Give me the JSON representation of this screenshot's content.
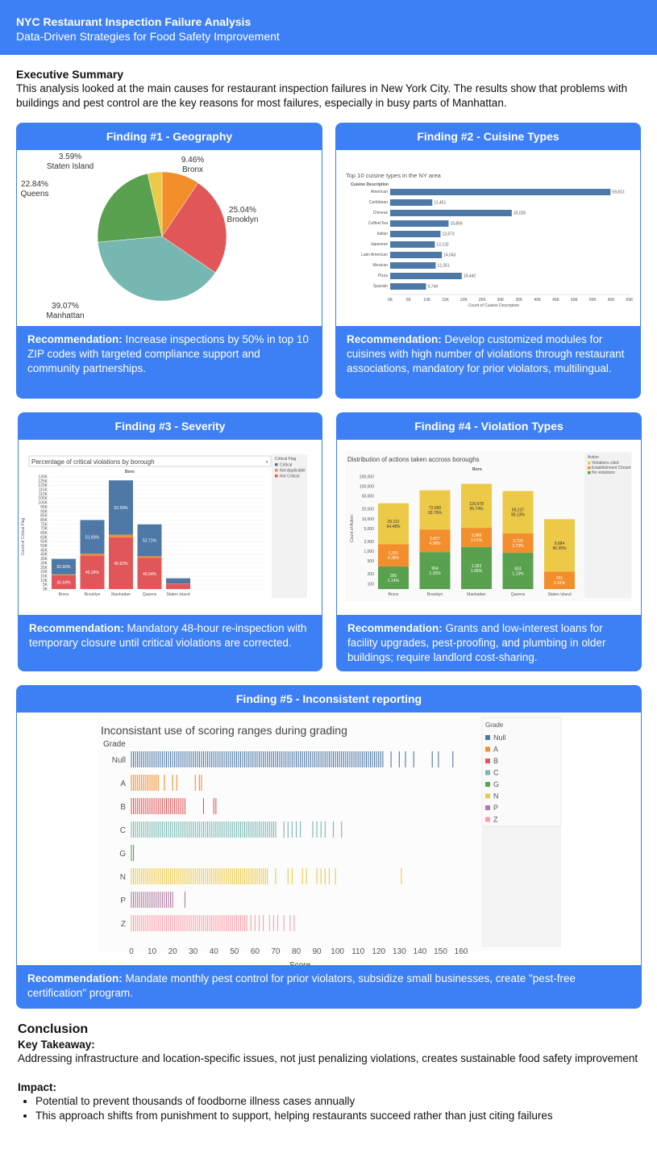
{
  "header": {
    "title": "NYC Restaurant Inspection Failure Analysis",
    "subtitle": "Data-Driven Strategies for Food Safety Improvement"
  },
  "executive_summary": {
    "heading": "Executive Summary",
    "text": "This analysis looked at the main causes for restaurant inspection failures in New York City. The results show that problems with buildings and pest control are the key reasons for most failures, especially in busy parts of Manhattan."
  },
  "findings": [
    {
      "title": "Finding #1 - Geography",
      "rec_label": "Recommendation:",
      "rec_text": " Increase inspections by 50% in top 10 ZIP codes with targeted compliance support and community partnerships."
    },
    {
      "title": "Finding #2 - Cuisine Types",
      "rec_label": "Recommendation:",
      "rec_text": " Develop customized modules for cuisines with high number of violations through restaurant associations, mandatory for prior violators, multilingual."
    },
    {
      "title": "Finding #3 - Severity",
      "rec_label": "Recommendation:",
      "rec_text": " Mandatory 48-hour re-inspection with temporary closure until critical violations are corrected."
    },
    {
      "title": "Finding #4 - Violation Types",
      "rec_label": "Recommendation:",
      "rec_text": " Grants and low-interest loans for facility upgrades, pest-proofing, and plumbing in older buildings; require landlord cost-sharing."
    },
    {
      "title": "Finding #5 - Inconsistent reporting",
      "rec_label": "Recommendation:",
      "rec_text": " Mandate monthly pest control for prior violators, subsidize small businesses, create \"pest-free certification\" program."
    }
  ],
  "conclusion": {
    "heading": "Conclusion",
    "takeaway_heading": "Key Takeaway:",
    "takeaway_text": "Addressing infrastructure and location-specific issues, not just penalizing violations, creates sustainable food safety improvement",
    "impact_heading": "Impact:",
    "impact_items": [
      "Potential to prevent thousands of foodborne illness cases annually",
      "This approach shifts from punishment to support, helping restaurants succeed rather than just citing failures"
    ]
  },
  "chart_data": [
    {
      "type": "pie",
      "title": "",
      "labels": [
        "Bronx",
        "Brooklyn",
        "Manhattan",
        "Queens",
        "Staten Island"
      ],
      "values": [
        9.46,
        25.04,
        39.07,
        22.84,
        3.59
      ],
      "value_labels": [
        "9.46%",
        "25.04%",
        "39.07%",
        "22.84%",
        "3.59%"
      ],
      "colors": [
        "#f28e2b",
        "#e15759",
        "#76b7b2",
        "#59a14f",
        "#edc948"
      ]
    },
    {
      "type": "bar",
      "title": "Top 10 cuisine types in the NY area",
      "ylabel": "Cuisine Description",
      "xlabel": "Count of Cuisine Description",
      "categories": [
        "American",
        "Caribbean",
        "Chinese",
        "Coffee/Tea",
        "Italian",
        "Japanese",
        "Latin American",
        "Mexican",
        "Pizza",
        "Spanish"
      ],
      "values": [
        59813,
        11451,
        33026,
        15856,
        13673,
        12132,
        14043,
        12351,
        19440,
        9744
      ],
      "value_labels": [
        "59,813",
        "11,451",
        "33,026",
        "15,856",
        "13,673",
        "12,132",
        "14,043",
        "12,351",
        "19,440",
        "9,744"
      ],
      "xticks": [
        "0K",
        "5K",
        "10K",
        "15K",
        "20K",
        "25K",
        "30K",
        "35K",
        "40K",
        "45K",
        "50K",
        "55K",
        "60K",
        "65K"
      ],
      "xlim": [
        0,
        65000
      ],
      "color": "#4e79a7"
    },
    {
      "type": "bar",
      "title": "Percentage of critical violations by borough",
      "xlabel": "Boro",
      "ylabel": "Count of Critical Flag",
      "categories": [
        "Bronx",
        "Brooklyn",
        "Manhattan",
        "Queens",
        "Staten Island"
      ],
      "yticks": [
        "0K",
        "5K",
        "10K",
        "15K",
        "20K",
        "25K",
        "30K",
        "35K",
        "40K",
        "45K",
        "50K",
        "55K",
        "60K",
        "65K",
        "70K",
        "75K",
        "80K",
        "85K",
        "90K",
        "95K",
        "100K",
        "105K",
        "110K",
        "115K",
        "120K",
        "125K",
        "130K"
      ],
      "ylim": [
        0,
        130000
      ],
      "legend_title": "Critical Flag",
      "legend": [
        "Critical",
        "Not Applicable",
        "Not Critical"
      ],
      "series": [
        {
          "name": "Not Critical",
          "color": "#e15759",
          "values": [
            16000,
            39000,
            60000,
            36000,
            6000
          ],
          "labels": [
            "45.64%",
            "45.34%",
            "45.62%",
            "45.54%",
            ""
          ]
        },
        {
          "name": "Not Applicable",
          "color": "#f28e2b",
          "values": [
            1000,
            2000,
            3000,
            2000,
            300
          ],
          "labels": [
            "",
            "",
            "",
            "",
            ""
          ]
        },
        {
          "name": "Critical",
          "color": "#4e79a7",
          "values": [
            18000,
            39000,
            63000,
            37000,
            6200
          ],
          "labels": [
            "52.60%",
            "51.83%",
            "52.59%",
            "52.71%",
            ""
          ]
        }
      ]
    },
    {
      "type": "bar",
      "title": "Distribution of actions taken accross boroughs",
      "xlabel": "Boro",
      "ylabel": "Count of Action",
      "categories": [
        "Bronx",
        "Brooklyn",
        "Manhattan",
        "Queens",
        "Staten Island"
      ],
      "yticks": [
        "100",
        "200",
        "500",
        "1,000",
        "2,000",
        "5,000",
        "10,000",
        "20,000",
        "50,000",
        "100,000",
        "200,000"
      ],
      "scale": "log",
      "legend_title": "Action",
      "legend": [
        "Violations cited",
        "Establishment Closed",
        "No violations"
      ],
      "series": [
        {
          "name": "No violations",
          "color": "#59a14f",
          "values": [
            350,
            964,
            1393,
            924,
            null
          ],
          "labels": [
            "350\n1.14%",
            "964\n1.26%",
            "1,393\n1.05%",
            "924\n1.13%",
            ""
          ]
        },
        {
          "name": "Establishment Closed",
          "color": "#f28e2b",
          "values": [
            1351,
            3827,
            3989,
            2720,
            241
          ],
          "labels": [
            "1,351\n4.38%",
            "3,827\n4.98%",
            "3,989\n3.21%",
            "2,720\n3.73%",
            "241\n2.41%"
          ]
        },
        {
          "name": "Violations cited",
          "color": "#edc948",
          "values": [
            29112,
            72000,
            116678,
            69237,
            9684
          ],
          "labels": [
            "29,112\n94.48%",
            "72,000\n93.76%",
            "116,678\n95.74%",
            "69,237\n95.13%",
            "9,684\n96.95%"
          ]
        }
      ]
    },
    {
      "type": "scatter",
      "title": "Inconsistant use of scoring ranges during grading",
      "xlabel": "Score",
      "ylabel": "Grade",
      "categories": [
        "Null",
        "A",
        "B",
        "C",
        "G",
        "N",
        "P",
        "Z"
      ],
      "xticks": [
        "0",
        "10",
        "20",
        "30",
        "40",
        "50",
        "60",
        "70",
        "80",
        "90",
        "100",
        "110",
        "120",
        "130",
        "140",
        "150",
        "160"
      ],
      "xlim": [
        0,
        160
      ],
      "legend_title": "Grade",
      "legend": [
        "Null",
        "A",
        "B",
        "C",
        "G",
        "N",
        "P",
        "Z"
      ],
      "colors": [
        "#4e79a7",
        "#f28e2b",
        "#e15759",
        "#76b7b2",
        "#59a14f",
        "#edc948",
        "#b07aa1",
        "#ff9da7"
      ],
      "ranges": [
        {
          "grade": "Null",
          "dense_max": 122,
          "extra": [
            126,
            130,
            133,
            137,
            146,
            149,
            156
          ]
        },
        {
          "grade": "A",
          "dense_max": 13,
          "extra": [
            16,
            20,
            22,
            31,
            33,
            34
          ]
        },
        {
          "grade": "B",
          "dense_max": 26,
          "extra": [
            35,
            40,
            41
          ]
        },
        {
          "grade": "C",
          "dense_max": 70,
          "extra": [
            74,
            76,
            78,
            80,
            82,
            88,
            90,
            92,
            94,
            98,
            102
          ]
        },
        {
          "grade": "G",
          "dense_max": 0,
          "extra": [
            1
          ]
        },
        {
          "grade": "N",
          "dense_max": 66,
          "extra": [
            70,
            76,
            78,
            83,
            85,
            90,
            92,
            94,
            96,
            99,
            131
          ]
        },
        {
          "grade": "P",
          "dense_max": 20,
          "extra": [
            26
          ]
        },
        {
          "grade": "Z",
          "dense_max": 56,
          "extra": [
            58,
            60,
            62,
            64,
            67,
            69,
            71,
            74,
            77,
            79
          ]
        }
      ]
    }
  ]
}
